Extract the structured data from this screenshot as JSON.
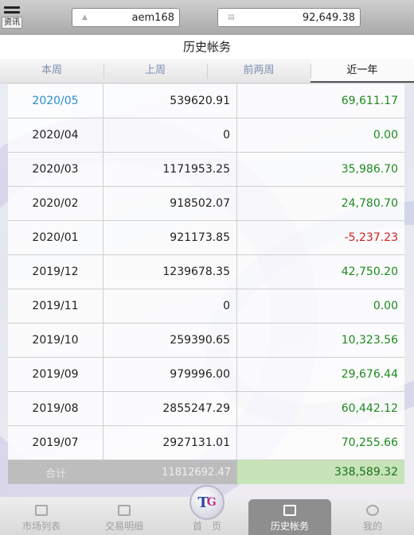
{
  "header": {
    "menu_label": "资讯",
    "username": "aem168",
    "balance": "92,649.38"
  },
  "title": "历史帐务",
  "tabs": [
    "本周",
    "上周",
    "前两周",
    "近一年"
  ],
  "rows": [
    {
      "period": "2020/05",
      "amount": "539620.91",
      "result": "69,611.17",
      "sign": "pos"
    },
    {
      "period": "2020/04",
      "amount": "0",
      "result": "0.00",
      "sign": "pos"
    },
    {
      "period": "2020/03",
      "amount": "1171953.25",
      "result": "35,986.70",
      "sign": "pos"
    },
    {
      "period": "2020/02",
      "amount": "918502.07",
      "result": "24,780.70",
      "sign": "pos"
    },
    {
      "period": "2020/01",
      "amount": "921173.85",
      "result": "-5,237.23",
      "sign": "neg"
    },
    {
      "period": "2019/12",
      "amount": "1239678.35",
      "result": "42,750.20",
      "sign": "pos"
    },
    {
      "period": "2019/11",
      "amount": "0",
      "result": "0.00",
      "sign": "pos"
    },
    {
      "period": "2019/10",
      "amount": "259390.65",
      "result": "10,323.56",
      "sign": "pos"
    },
    {
      "period": "2019/09",
      "amount": "979996.00",
      "result": "29,676.44",
      "sign": "pos"
    },
    {
      "period": "2019/08",
      "amount": "2855247.29",
      "result": "60,442.12",
      "sign": "pos"
    },
    {
      "period": "2019/07",
      "amount": "2927131.01",
      "result": "70,255.66",
      "sign": "pos"
    }
  ],
  "total": {
    "label": "合计",
    "amount": "11812692.47",
    "result": "338,589.32"
  },
  "nav": {
    "market": "市场列表",
    "trades": "交易明细",
    "home": "首　页",
    "history": "历史帐务",
    "mine": "我的",
    "logo_text": "T",
    "logo_sub": "G"
  },
  "colors": {
    "positive": "#1e8a1e",
    "negative": "#d42020",
    "link_blue": "#2a8fd0"
  }
}
